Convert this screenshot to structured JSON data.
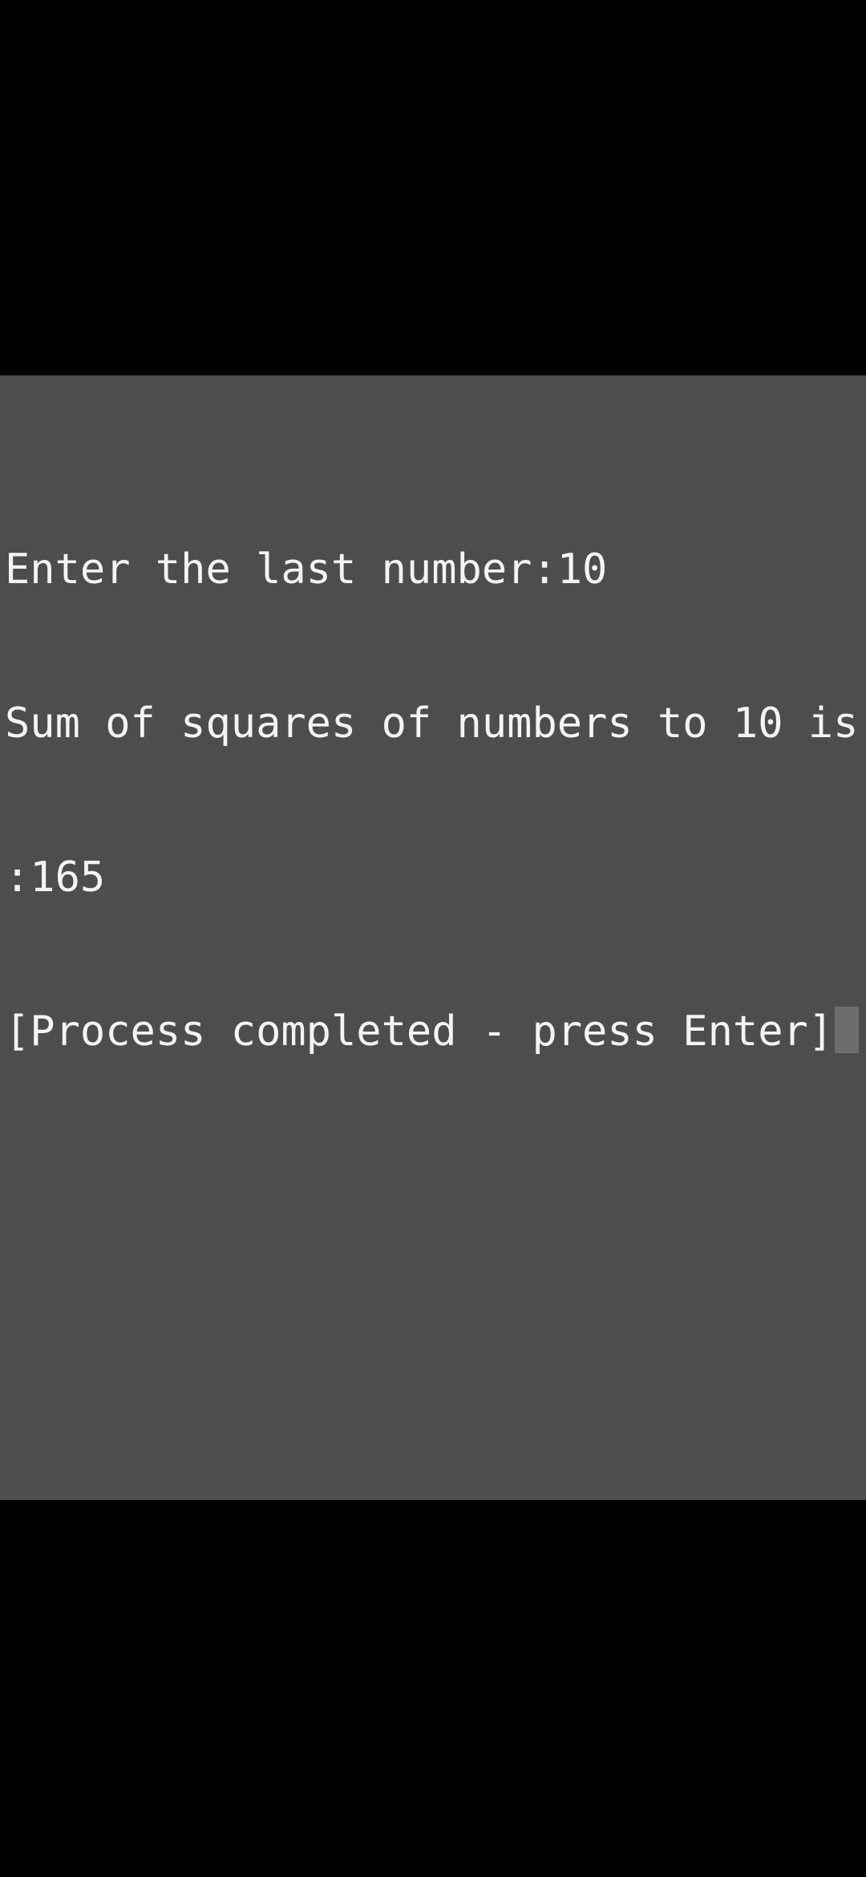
{
  "terminal": {
    "lines": [
      "Enter the last number:10",
      "Sum of squares of numbers to 10 is",
      ":165",
      "[Process completed - press Enter]"
    ]
  },
  "colors": {
    "terminal_bg": "#4d4e4c",
    "text": "#f4f4f4",
    "cursor": "#6d6e6c",
    "outer_bg": "#000000"
  }
}
